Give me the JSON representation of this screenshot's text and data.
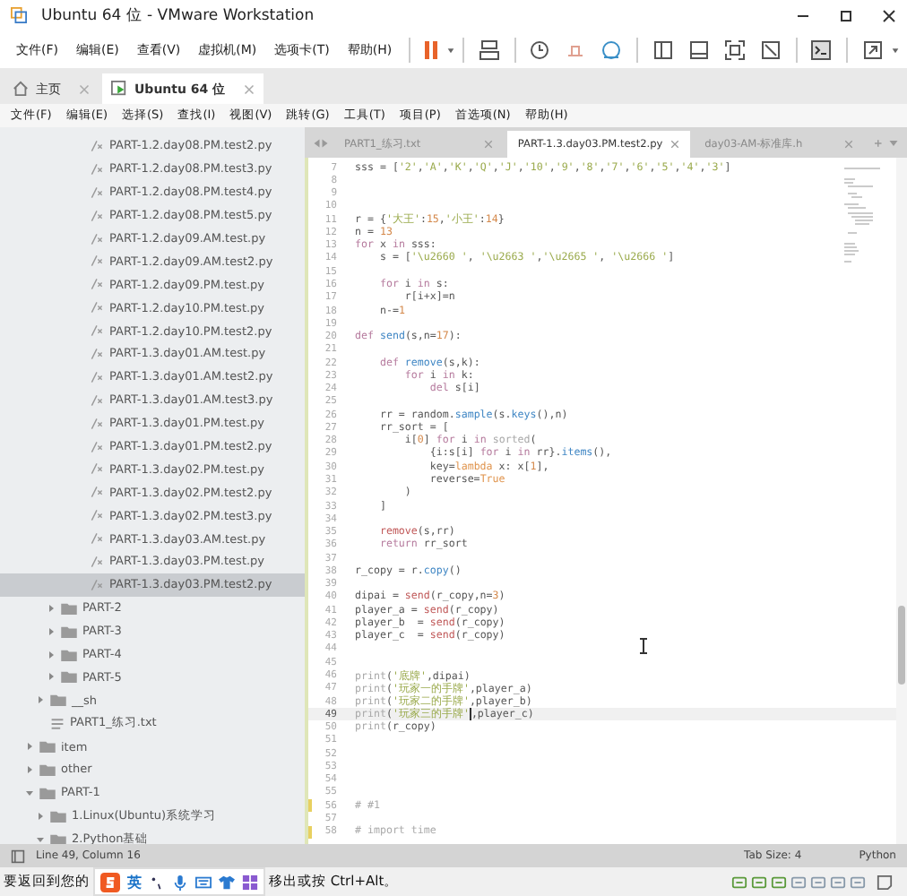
{
  "window": {
    "title": "Ubuntu 64 位 - VMware Workstation"
  },
  "vm_menu": [
    "文件(F)",
    "编辑(E)",
    "查看(V)",
    "虚拟机(M)",
    "选项卡(T)",
    "帮助(H)"
  ],
  "vm_tabs": [
    {
      "label": "主页",
      "kind": "home",
      "selected": false
    },
    {
      "label": "Ubuntu 64 位",
      "kind": "vm",
      "selected": true
    }
  ],
  "editor_menu": [
    "文件(F)",
    "编辑(E)",
    "选择(S)",
    "查找(I)",
    "视图(V)",
    "跳转(G)",
    "工具(T)",
    "项目(P)",
    "首选项(N)",
    "帮助(H)"
  ],
  "tree": [
    {
      "children": [
        {
          "children": [
            {
              "children": [
                {
                  "name": "PART-1.2.day08.PM.test2.py",
                  "kind": "file",
                  "selected": false
                },
                {
                  "name": "PART-1.2.day08.PM.test3.py",
                  "kind": "file",
                  "selected": false
                },
                {
                  "name": "PART-1.2.day08.PM.test4.py",
                  "kind": "file",
                  "selected": false
                },
                {
                  "name": "PART-1.2.day08.PM.test5.py",
                  "kind": "file",
                  "selected": false
                },
                {
                  "name": "PART-1.2.day09.AM.test.py",
                  "kind": "file",
                  "selected": false
                },
                {
                  "name": "PART-1.2.day09.AM.test2.py",
                  "kind": "file",
                  "selected": false
                },
                {
                  "name": "PART-1.2.day09.PM.test.py",
                  "kind": "file",
                  "selected": false
                },
                {
                  "name": "PART-1.2.day10.PM.test.py",
                  "kind": "file",
                  "selected": false
                },
                {
                  "name": "PART-1.2.day10.PM.test2.py",
                  "kind": "file",
                  "selected": false
                },
                {
                  "name": "PART-1.3.day01.AM.test.py",
                  "kind": "file",
                  "selected": false
                },
                {
                  "name": "PART-1.3.day01.AM.test2.py",
                  "kind": "file",
                  "selected": false
                },
                {
                  "name": "PART-1.3.day01.AM.test3.py",
                  "kind": "file",
                  "selected": false
                },
                {
                  "name": "PART-1.3.day01.PM.test.py",
                  "kind": "file",
                  "selected": false
                },
                {
                  "name": "PART-1.3.day01.PM.test2.py",
                  "kind": "file",
                  "selected": false
                },
                {
                  "name": "PART-1.3.day02.PM.test.py",
                  "kind": "file",
                  "selected": false
                },
                {
                  "name": "PART-1.3.day02.PM.test2.py",
                  "kind": "file",
                  "selected": false
                },
                {
                  "name": "PART-1.3.day02.PM.test3.py",
                  "kind": "file",
                  "selected": false
                },
                {
                  "name": "PART-1.3.day03.AM.test.py",
                  "kind": "file",
                  "selected": false
                },
                {
                  "name": "PART-1.3.day03.PM.test.py",
                  "kind": "file",
                  "selected": false
                },
                {
                  "name": "PART-1.3.day03.PM.test2.py",
                  "kind": "file",
                  "selected": true
                }
              ]
            },
            {
              "name": "PART-2",
              "kind": "folder",
              "expanded": false,
              "selected": false
            },
            {
              "name": "PART-3",
              "kind": "folder",
              "expanded": false,
              "selected": false
            },
            {
              "name": "PART-4",
              "kind": "folder",
              "expanded": false,
              "selected": false
            },
            {
              "name": "PART-5",
              "kind": "folder",
              "expanded": false,
              "selected": false
            }
          ]
        },
        {
          "name": "__sh",
          "kind": "folder",
          "expanded": false,
          "selected": false
        },
        {
          "name": "PART1_练习.txt",
          "kind": "text",
          "selected": false
        }
      ]
    },
    {
      "name": "item",
      "kind": "folder",
      "expanded": false,
      "selected": false
    },
    {
      "name": "other",
      "kind": "folder",
      "expanded": false,
      "selected": false
    },
    {
      "name": "PART-1",
      "kind": "folder",
      "expanded": true,
      "selected": false,
      "children": [
        {
          "name": "1.Linux(Ubuntu)系统学习",
          "kind": "folder",
          "expanded": false,
          "selected": false
        },
        {
          "name": "2.Python基础",
          "kind": "folder",
          "expanded": true,
          "selected": false
        }
      ]
    }
  ],
  "editor_tabs": [
    {
      "label": "PART1_练习.txt",
      "selected": false
    },
    {
      "label": "PART-1.3.day03.PM.test2.py",
      "selected": true
    },
    {
      "label": "day03-AM-标准库.h",
      "selected": false
    }
  ],
  "code": {
    "lines": [
      {
        "n": "7",
        "current": false,
        "modified": false,
        "tokens": [
          {
            "kind": "plain",
            "text": "sss = ["
          },
          {
            "kind": "string",
            "text": "'2'"
          },
          {
            "kind": "plain",
            "text": ","
          },
          {
            "kind": "string",
            "text": "'A'"
          },
          {
            "kind": "plain",
            "text": ","
          },
          {
            "kind": "string",
            "text": "'K'"
          },
          {
            "kind": "plain",
            "text": ","
          },
          {
            "kind": "string",
            "text": "'Q'"
          },
          {
            "kind": "plain",
            "text": ","
          },
          {
            "kind": "string",
            "text": "'J'"
          },
          {
            "kind": "plain",
            "text": ","
          },
          {
            "kind": "string",
            "text": "'10'"
          },
          {
            "kind": "plain",
            "text": ","
          },
          {
            "kind": "string",
            "text": "'9'"
          },
          {
            "kind": "plain",
            "text": ","
          },
          {
            "kind": "string",
            "text": "'8'"
          },
          {
            "kind": "plain",
            "text": ","
          },
          {
            "kind": "string",
            "text": "'7'"
          },
          {
            "kind": "plain",
            "text": ","
          },
          {
            "kind": "string",
            "text": "'6'"
          },
          {
            "kind": "plain",
            "text": ","
          },
          {
            "kind": "string",
            "text": "'5'"
          },
          {
            "kind": "plain",
            "text": ","
          },
          {
            "kind": "string",
            "text": "'4'"
          },
          {
            "kind": "plain",
            "text": ","
          },
          {
            "kind": "string",
            "text": "'3'"
          },
          {
            "kind": "plain",
            "text": "]"
          }
        ]
      },
      {
        "n": "8",
        "current": false,
        "modified": false
      },
      {
        "n": "9",
        "current": false,
        "modified": false
      },
      {
        "n": "10",
        "current": false,
        "modified": false
      },
      {
        "n": "11",
        "current": false,
        "modified": false,
        "tokens": [
          {
            "kind": "plain",
            "text": "r = {"
          },
          {
            "kind": "string",
            "text": "'大王'"
          },
          {
            "kind": "plain",
            "text": ":"
          },
          {
            "kind": "number",
            "text": "15"
          },
          {
            "kind": "plain",
            "text": ","
          },
          {
            "kind": "string",
            "text": "'小王'"
          },
          {
            "kind": "plain",
            "text": ":"
          },
          {
            "kind": "number",
            "text": "14"
          },
          {
            "kind": "plain",
            "text": "}"
          }
        ]
      },
      {
        "n": "12",
        "current": false,
        "modified": false,
        "tokens": [
          {
            "kind": "plain",
            "text": "n = "
          },
          {
            "kind": "number",
            "text": "13"
          }
        ]
      },
      {
        "n": "13",
        "current": false,
        "modified": false,
        "tokens": [
          {
            "kind": "keyword",
            "text": "for"
          },
          {
            "kind": "plain",
            "text": " x "
          },
          {
            "kind": "keyword",
            "text": "in"
          },
          {
            "kind": "plain",
            "text": " sss:"
          }
        ]
      },
      {
        "n": "14",
        "current": false,
        "modified": false,
        "tokens": [
          {
            "kind": "plain",
            "text": "    s = ["
          },
          {
            "kind": "string",
            "text": "'\\u2660 '"
          },
          {
            "kind": "plain",
            "text": ", "
          },
          {
            "kind": "string",
            "text": "'\\u2663 '"
          },
          {
            "kind": "plain",
            "text": ","
          },
          {
            "kind": "string",
            "text": "'\\u2665 '"
          },
          {
            "kind": "plain",
            "text": ", "
          },
          {
            "kind": "string",
            "text": "'\\u2666 '"
          },
          {
            "kind": "plain",
            "text": "]"
          }
        ]
      },
      {
        "n": "15",
        "current": false,
        "modified": false
      },
      {
        "n": "16",
        "current": false,
        "modified": false,
        "tokens": [
          {
            "kind": "keyword",
            "text": "    for"
          },
          {
            "kind": "plain",
            "text": " i "
          },
          {
            "kind": "keyword",
            "text": "in"
          },
          {
            "kind": "plain",
            "text": " s:"
          }
        ]
      },
      {
        "n": "17",
        "current": false,
        "modified": false,
        "tokens": [
          {
            "kind": "plain",
            "text": "        r[i+x]=n"
          }
        ]
      },
      {
        "n": "18",
        "current": false,
        "modified": false,
        "tokens": [
          {
            "kind": "plain",
            "text": "    n-="
          },
          {
            "kind": "number",
            "text": "1"
          }
        ]
      },
      {
        "n": "19",
        "current": false,
        "modified": false
      },
      {
        "n": "20",
        "current": false,
        "modified": false,
        "tokens": [
          {
            "kind": "keyword",
            "text": "def "
          },
          {
            "kind": "func",
            "text": "send"
          },
          {
            "kind": "plain",
            "text": "(s,n="
          },
          {
            "kind": "number",
            "text": "17"
          },
          {
            "kind": "plain",
            "text": "):"
          }
        ]
      },
      {
        "n": "21",
        "current": false,
        "modified": false
      },
      {
        "n": "22",
        "current": false,
        "modified": false,
        "tokens": [
          {
            "kind": "keyword",
            "text": "    def "
          },
          {
            "kind": "func",
            "text": "remove"
          },
          {
            "kind": "plain",
            "text": "(s,k):"
          }
        ]
      },
      {
        "n": "23",
        "current": false,
        "modified": false,
        "tokens": [
          {
            "kind": "keyword",
            "text": "        for"
          },
          {
            "kind": "plain",
            "text": " i "
          },
          {
            "kind": "keyword",
            "text": "in"
          },
          {
            "kind": "plain",
            "text": " k:"
          }
        ]
      },
      {
        "n": "24",
        "current": false,
        "modified": false,
        "tokens": [
          {
            "kind": "keyword",
            "text": "            del"
          },
          {
            "kind": "plain",
            "text": " s[i]"
          }
        ]
      },
      {
        "n": "25",
        "current": false,
        "modified": false
      },
      {
        "n": "26",
        "current": false,
        "modified": false,
        "tokens": [
          {
            "kind": "plain",
            "text": "    rr = random."
          },
          {
            "kind": "func",
            "text": "sample"
          },
          {
            "kind": "plain",
            "text": "(s."
          },
          {
            "kind": "func",
            "text": "keys"
          },
          {
            "kind": "plain",
            "text": "(),n)"
          }
        ]
      },
      {
        "n": "27",
        "current": false,
        "modified": false,
        "tokens": [
          {
            "kind": "plain",
            "text": "    rr_sort = ["
          }
        ]
      },
      {
        "n": "28",
        "current": false,
        "modified": false,
        "tokens": [
          {
            "kind": "plain",
            "text": "        i["
          },
          {
            "kind": "number",
            "text": "0"
          },
          {
            "kind": "plain",
            "text": "] "
          },
          {
            "kind": "keyword",
            "text": "for"
          },
          {
            "kind": "plain",
            "text": " i "
          },
          {
            "kind": "keyword",
            "text": "in "
          },
          {
            "kind": "builtin",
            "text": "sorted"
          },
          {
            "kind": "plain",
            "text": "("
          }
        ]
      },
      {
        "n": "29",
        "current": false,
        "modified": false,
        "tokens": [
          {
            "kind": "plain",
            "text": "            {i:s[i] "
          },
          {
            "kind": "keyword",
            "text": "for"
          },
          {
            "kind": "plain",
            "text": " i "
          },
          {
            "kind": "keyword",
            "text": "in"
          },
          {
            "kind": "plain",
            "text": " rr}."
          },
          {
            "kind": "func",
            "text": "items"
          },
          {
            "kind": "plain",
            "text": "(),"
          }
        ]
      },
      {
        "n": "30",
        "current": false,
        "modified": false,
        "tokens": [
          {
            "kind": "plain",
            "text": "            key="
          },
          {
            "kind": "constant",
            "text": "lambda"
          },
          {
            "kind": "plain",
            "text": " x: x["
          },
          {
            "kind": "number",
            "text": "1"
          },
          {
            "kind": "plain",
            "text": "],"
          }
        ]
      },
      {
        "n": "31",
        "current": false,
        "modified": false,
        "tokens": [
          {
            "kind": "plain",
            "text": "            reverse="
          },
          {
            "kind": "constant",
            "text": "True"
          }
        ]
      },
      {
        "n": "32",
        "current": false,
        "modified": false,
        "tokens": [
          {
            "kind": "plain",
            "text": "        )"
          }
        ]
      },
      {
        "n": "33",
        "current": false,
        "modified": false,
        "tokens": [
          {
            "kind": "plain",
            "text": "    ]"
          }
        ]
      },
      {
        "n": "34",
        "current": false,
        "modified": false
      },
      {
        "n": "35",
        "current": false,
        "modified": false,
        "tokens": [
          {
            "kind": "call",
            "text": "    remove"
          },
          {
            "kind": "plain",
            "text": "(s,rr)"
          }
        ]
      },
      {
        "n": "36",
        "current": false,
        "modified": false,
        "tokens": [
          {
            "kind": "keyword",
            "text": "    return"
          },
          {
            "kind": "plain",
            "text": " rr_sort"
          }
        ]
      },
      {
        "n": "37",
        "current": false,
        "modified": false
      },
      {
        "n": "38",
        "current": false,
        "modified": false,
        "tokens": [
          {
            "kind": "plain",
            "text": "r_copy = r."
          },
          {
            "kind": "func",
            "text": "copy"
          },
          {
            "kind": "plain",
            "text": "()"
          }
        ]
      },
      {
        "n": "39",
        "current": false,
        "modified": false
      },
      {
        "n": "40",
        "current": false,
        "modified": false,
        "tokens": [
          {
            "kind": "plain",
            "text": "dipai = "
          },
          {
            "kind": "call",
            "text": "send"
          },
          {
            "kind": "plain",
            "text": "(r_copy,n="
          },
          {
            "kind": "number",
            "text": "3"
          },
          {
            "kind": "plain",
            "text": ")"
          }
        ]
      },
      {
        "n": "41",
        "current": false,
        "modified": false,
        "tokens": [
          {
            "kind": "plain",
            "text": "player_a = "
          },
          {
            "kind": "call",
            "text": "send"
          },
          {
            "kind": "plain",
            "text": "(r_copy)"
          }
        ]
      },
      {
        "n": "42",
        "current": false,
        "modified": false,
        "tokens": [
          {
            "kind": "plain",
            "text": "player_b  = "
          },
          {
            "kind": "call",
            "text": "send"
          },
          {
            "kind": "plain",
            "text": "(r_copy)"
          }
        ]
      },
      {
        "n": "43",
        "current": false,
        "modified": false,
        "tokens": [
          {
            "kind": "plain",
            "text": "player_c  = "
          },
          {
            "kind": "call",
            "text": "send"
          },
          {
            "kind": "plain",
            "text": "(r_copy)"
          }
        ]
      },
      {
        "n": "44",
        "current": false,
        "modified": false
      },
      {
        "n": "45",
        "current": false,
        "modified": false
      },
      {
        "n": "46",
        "current": false,
        "modified": false,
        "tokens": [
          {
            "kind": "builtin",
            "text": "print"
          },
          {
            "kind": "plain",
            "text": "("
          },
          {
            "kind": "string",
            "text": "'底牌'"
          },
          {
            "kind": "plain",
            "text": ",dipai)"
          }
        ]
      },
      {
        "n": "47",
        "current": false,
        "modified": false,
        "tokens": [
          {
            "kind": "builtin",
            "text": "print"
          },
          {
            "kind": "plain",
            "text": "("
          },
          {
            "kind": "string",
            "text": "'玩家一的手牌'"
          },
          {
            "kind": "plain",
            "text": ",player_a)"
          }
        ]
      },
      {
        "n": "48",
        "current": false,
        "modified": false,
        "tokens": [
          {
            "kind": "builtin",
            "text": "print"
          },
          {
            "kind": "plain",
            "text": "("
          },
          {
            "kind": "string",
            "text": "'玩家二的手牌'"
          },
          {
            "kind": "plain",
            "text": ",player_b)"
          }
        ]
      },
      {
        "n": "49",
        "current": true,
        "modified": false,
        "tokens": [
          {
            "kind": "builtin",
            "text": "print"
          },
          {
            "kind": "plain",
            "text": "("
          },
          {
            "kind": "string",
            "text": "'玩家三的手牌'"
          },
          {
            "kind": "plain",
            "text": ",player_c)"
          }
        ]
      },
      {
        "n": "50",
        "current": false,
        "modified": false,
        "tokens": [
          {
            "kind": "builtin",
            "text": "print"
          },
          {
            "kind": "plain",
            "text": "(r_copy)"
          }
        ]
      },
      {
        "n": "51",
        "current": false,
        "modified": false
      },
      {
        "n": "52",
        "current": false,
        "modified": false
      },
      {
        "n": "53",
        "current": false,
        "modified": false
      },
      {
        "n": "54",
        "current": false,
        "modified": false
      },
      {
        "n": "55",
        "current": false,
        "modified": false
      },
      {
        "n": "56",
        "current": false,
        "modified": true,
        "tokens": [
          {
            "kind": "comment",
            "text": "# #1"
          }
        ]
      },
      {
        "n": "57",
        "current": false,
        "modified": false
      },
      {
        "n": "58",
        "current": false,
        "modified": true,
        "tokens": [
          {
            "kind": "comment",
            "text": "# import time"
          }
        ]
      }
    ]
  },
  "status_bar": {
    "position": "Line 49, Column 16",
    "tab_size": "Tab Size: 4",
    "syntax": "Python"
  },
  "vm_status": {
    "message_start": "要返回到您的",
    "ime_mode": "英",
    "message_end": "移出或按 Ctrl+Alt。"
  }
}
